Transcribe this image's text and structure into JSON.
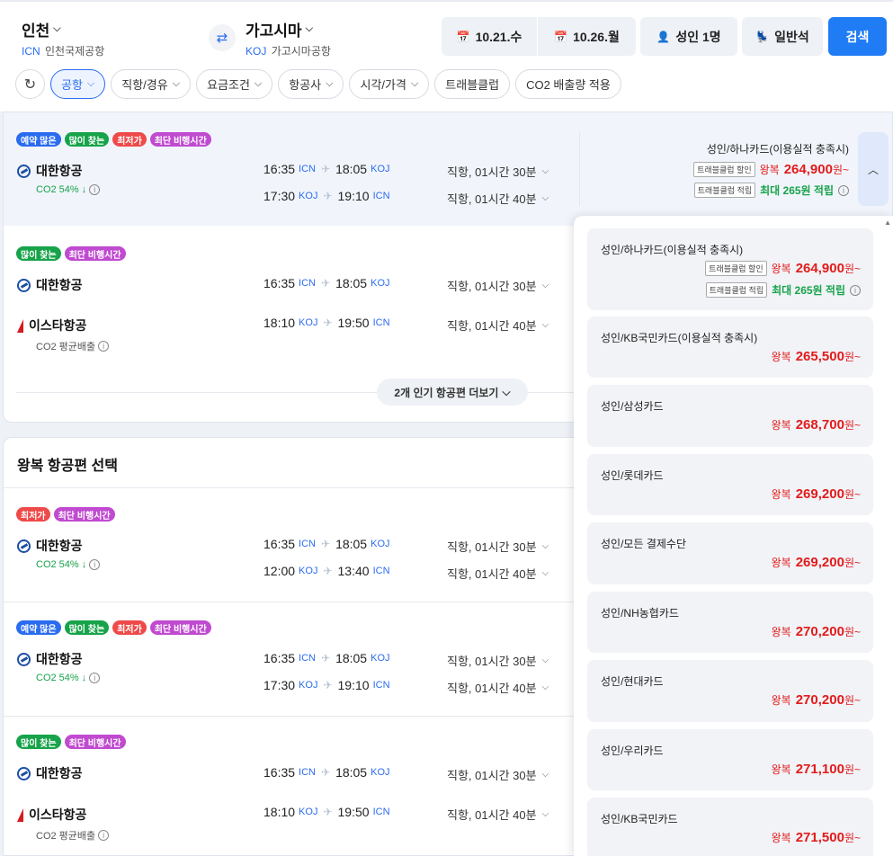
{
  "header": {
    "origin": {
      "city": "인천",
      "code": "ICN",
      "airport": "인천국제공항"
    },
    "destination": {
      "city": "가고시마",
      "code": "KOJ",
      "airport": "가고시마공항"
    },
    "depart_date": "10.21.수",
    "return_date": "10.26.월",
    "passengers": "성인 1명",
    "cabin": "일반석",
    "search_label": "검색"
  },
  "filters": [
    {
      "label": "공항",
      "has_chevron": true,
      "active": true
    },
    {
      "label": "직항/경유",
      "has_chevron": true,
      "active": false
    },
    {
      "label": "요금조건",
      "has_chevron": true,
      "active": false
    },
    {
      "label": "항공사",
      "has_chevron": true,
      "active": false
    },
    {
      "label": "시각/가격",
      "has_chevron": true,
      "active": false
    },
    {
      "label": "트래블클럽",
      "has_chevron": false,
      "active": false
    },
    {
      "label": "CO2 배출량 적용",
      "has_chevron": false,
      "active": false
    }
  ],
  "outbound_results": [
    {
      "badges": [
        "예약 많은",
        "많이 찾는",
        "최저가",
        "최단 비행시간"
      ],
      "legs": [
        {
          "airline": "대한항공",
          "dep_time": "16:35",
          "dep_code": "ICN",
          "arr_time": "18:05",
          "arr_code": "KOJ",
          "duration": "직항, 01시간 30분"
        },
        {
          "airline": "",
          "dep_time": "17:30",
          "dep_code": "KOJ",
          "arr_time": "19:10",
          "arr_code": "ICN",
          "duration": "직항, 01시간 40분"
        }
      ],
      "co2": "CO2 54% ↓",
      "price": {
        "title": "성인/하나카드(이용실적 충족시)",
        "tag1": "트래블클럽 할인",
        "rt": "왕복",
        "amount": "264,900",
        "unit": "원~",
        "tag2": "트래블클럽 적립",
        "reward": "최대 265원 적립"
      }
    },
    {
      "badges": [
        "많이 찾는",
        "최단 비행시간"
      ],
      "legs": [
        {
          "airline": "대한항공",
          "dep_time": "16:35",
          "dep_code": "ICN",
          "arr_time": "18:05",
          "arr_code": "KOJ",
          "duration": "직항, 01시간 30분"
        },
        {
          "airline": "이스타항공",
          "dep_time": "18:10",
          "dep_code": "KOJ",
          "arr_time": "19:50",
          "arr_code": "ICN",
          "duration": "직항, 01시간 40분"
        }
      ],
      "co2": "CO2 평균배출",
      "more_label": "2개 인기 항공편 더보기"
    }
  ],
  "return_section": {
    "title": "왕복 항공편 선택",
    "results": [
      {
        "badges": [
          "최저가",
          "최단 비행시간"
        ],
        "legs": [
          {
            "airline": "대한항공",
            "dep_time": "16:35",
            "dep_code": "ICN",
            "arr_time": "18:05",
            "arr_code": "KOJ",
            "duration": "직항, 01시간 30분"
          },
          {
            "airline": "",
            "dep_time": "12:00",
            "dep_code": "KOJ",
            "arr_time": "13:40",
            "arr_code": "ICN",
            "duration": "직항, 01시간 40분"
          }
        ],
        "co2": "CO2 54% ↓"
      },
      {
        "badges": [
          "예약 많은",
          "많이 찾는",
          "최저가",
          "최단 비행시간"
        ],
        "legs": [
          {
            "airline": "대한항공",
            "dep_time": "16:35",
            "dep_code": "ICN",
            "arr_time": "18:05",
            "arr_code": "KOJ",
            "duration": "직항, 01시간 30분"
          },
          {
            "airline": "",
            "dep_time": "17:30",
            "dep_code": "KOJ",
            "arr_time": "19:10",
            "arr_code": "ICN",
            "duration": "직항, 01시간 40분"
          }
        ],
        "co2": "CO2 54% ↓"
      },
      {
        "badges": [
          "많이 찾는",
          "최단 비행시간"
        ],
        "legs": [
          {
            "airline": "대한항공",
            "dep_time": "16:35",
            "dep_code": "ICN",
            "arr_time": "18:05",
            "arr_code": "KOJ",
            "duration": "직항, 01시간 30분"
          },
          {
            "airline": "이스타항공",
            "dep_time": "18:10",
            "dep_code": "KOJ",
            "arr_time": "19:50",
            "arr_code": "ICN",
            "duration": "직항, 01시간 40분"
          }
        ],
        "co2": "CO2 평균배출"
      }
    ]
  },
  "fare_options": [
    {
      "title": "성인/하나카드(이용실적 충족시)",
      "tag1": "트래블클럽 할인",
      "rt": "왕복",
      "amount": "264,900",
      "unit": "원~",
      "tag2": "트래블클럽 적립",
      "reward": "최대 265원 적립"
    },
    {
      "title": "성인/KB국민카드(이용실적 충족시)",
      "rt": "왕복",
      "amount": "265,500",
      "unit": "원~"
    },
    {
      "title": "성인/삼성카드",
      "rt": "왕복",
      "amount": "268,700",
      "unit": "원~"
    },
    {
      "title": "성인/롯데카드",
      "rt": "왕복",
      "amount": "269,200",
      "unit": "원~"
    },
    {
      "title": "성인/모든 결제수단",
      "rt": "왕복",
      "amount": "269,200",
      "unit": "원~"
    },
    {
      "title": "성인/NH농협카드",
      "rt": "왕복",
      "amount": "270,200",
      "unit": "원~"
    },
    {
      "title": "성인/현대카드",
      "rt": "왕복",
      "amount": "270,200",
      "unit": "원~"
    },
    {
      "title": "성인/우리카드",
      "rt": "왕복",
      "amount": "271,100",
      "unit": "원~"
    },
    {
      "title": "성인/KB국민카드",
      "rt": "왕복",
      "amount": "271,500",
      "unit": "원~"
    }
  ],
  "colors": {
    "accent": "#1f7cf5",
    "price": "#e21b1b",
    "eco": "#17a34a",
    "badge_blue": "#2a6cf0",
    "badge_green": "#17a34a",
    "badge_red": "#ef4a4a",
    "badge_purple": "#c04ad0"
  }
}
